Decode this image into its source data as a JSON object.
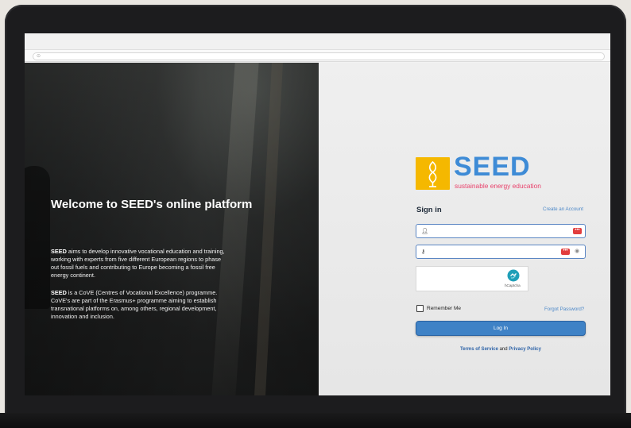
{
  "left": {
    "title": "Welcome to SEED's online platform",
    "para1_bold": "SEED",
    "para1_rest": " aims to develop innovative vocational education and training, working with experts from five different European regions to phase out fossil fuels and contributing to Europe becoming a fossil free energy continent.",
    "para2_bold": "SEED",
    "para2_rest": " is a CoVE (Centres of Vocational Excellence) programme. CoVE's are part of the Erasmus+ programme aiming to establish transnational platforms on, among others, regional development, innovation and inclusion."
  },
  "logo": {
    "name": "SEED",
    "tagline": "sustainable energy education"
  },
  "signin": {
    "title": "Sign in",
    "create_account": "Create an Account",
    "username_placeholder": "",
    "password_placeholder": "",
    "captcha_label": "hCaptcha",
    "remember_me": "Remember Me",
    "forgot_password": "Forgot Password?",
    "login_button": "Log In",
    "terms_of_service": "Terms of Service",
    "and": " and ",
    "privacy_policy": "Privacy Policy"
  },
  "icons": {
    "user": "user-icon",
    "key": "key-icon",
    "eye": "eye-icon",
    "password_manager": "password-manager-icon"
  },
  "colors": {
    "brand_blue": "#3e8bd6",
    "brand_pink": "#e9426c",
    "brand_yellow": "#f5b800",
    "button_blue": "#3f82c6"
  }
}
